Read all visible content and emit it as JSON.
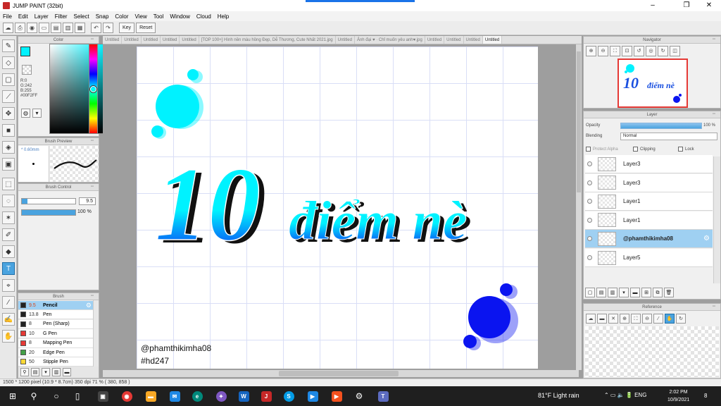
{
  "window": {
    "title": "JUMP PAINT (32bit)",
    "controls": [
      "–",
      "❐",
      "✕"
    ]
  },
  "menu": [
    "File",
    "Edit",
    "Layer",
    "Filter",
    "Select",
    "Snap",
    "Color",
    "View",
    "Tool",
    "Window",
    "Cloud",
    "Help"
  ],
  "toolbar": {
    "key_label": "Key",
    "reset_label": "Reset"
  },
  "color_panel": {
    "title": "Color",
    "foreground": "#00F2FF",
    "readout": [
      "R:0",
      "G:242",
      "B:255",
      "#00F2FF"
    ]
  },
  "brush_preview": {
    "title": "Brush Preview",
    "size": "* 0.60mm"
  },
  "brush_control": {
    "title": "Brush Control",
    "size_value": "9.5",
    "size_fill": 0.11,
    "opacity_value": "100 %",
    "opacity_fill": 1.0
  },
  "brush_list": {
    "title": "Brush",
    "items": [
      {
        "size": "9.5",
        "name": "Pencil",
        "color": "#222222",
        "active": true
      },
      {
        "size": "13.8",
        "name": "Pen",
        "color": "#222222",
        "active": false
      },
      {
        "size": "8",
        "name": "Pen (Sharp)",
        "color": "#222222",
        "active": false
      },
      {
        "size": "10",
        "name": "G Pen",
        "color": "#e53935",
        "active": false
      },
      {
        "size": "8",
        "name": "Mapping Pen",
        "color": "#e53935",
        "active": false
      },
      {
        "size": "20",
        "name": "Edge Pen",
        "color": "#43a047",
        "active": false
      },
      {
        "size": "50",
        "name": "Stipple Pen",
        "color": "#fdd835",
        "active": false
      }
    ]
  },
  "doc_tabs": [
    "Untitled",
    "Untitled",
    "Untitled",
    "Untitled",
    "Untitled",
    "[TOP 100+] Hình nền màu hồng Đẹp, Dễ Thương, Cute Nhất 2021.jpg",
    "Untitled",
    "Ảnh đại ♥ · Chỉ muốn yêu anh♥.jpg",
    "Untitled",
    "Untitled",
    "Untitled",
    "Untitled"
  ],
  "canvas": {
    "number_text": "10",
    "phrase_text": "điểm nè",
    "credit_1": "@phamthikimha08",
    "credit_2": "#hd247"
  },
  "navigator": {
    "title": "Navigator"
  },
  "layer_panel": {
    "title": "Layer",
    "opacity_label": "Opacity",
    "opacity_value": "100 %",
    "blending_label": "Blending",
    "blending_value": "Normal",
    "protect_alpha": "Protect Alpha",
    "clipping": "Clipping",
    "lock": "Lock",
    "layers": [
      {
        "name": "Layer3",
        "active": false
      },
      {
        "name": "Layer3",
        "active": false
      },
      {
        "name": "Layer1",
        "active": false
      },
      {
        "name": "Layer1",
        "active": false
      },
      {
        "name": "@phamthikimha08",
        "active": true
      },
      {
        "name": "Layer5",
        "active": false
      }
    ]
  },
  "reference": {
    "title": "Reference"
  },
  "status": "1500 * 1200 pixel   (10.9 * 8.7cm)   350 dpi   71 %   ( 380, 858 )",
  "taskbar": {
    "weather": "81°F  Light rain",
    "lang": "ENG",
    "time": "2:02 PM",
    "date": "10/9/2021",
    "notif": "8"
  },
  "colors": {
    "cyan": "#00F2FF",
    "blue": "#0A14F0",
    "accent": "#4AA3DF"
  }
}
